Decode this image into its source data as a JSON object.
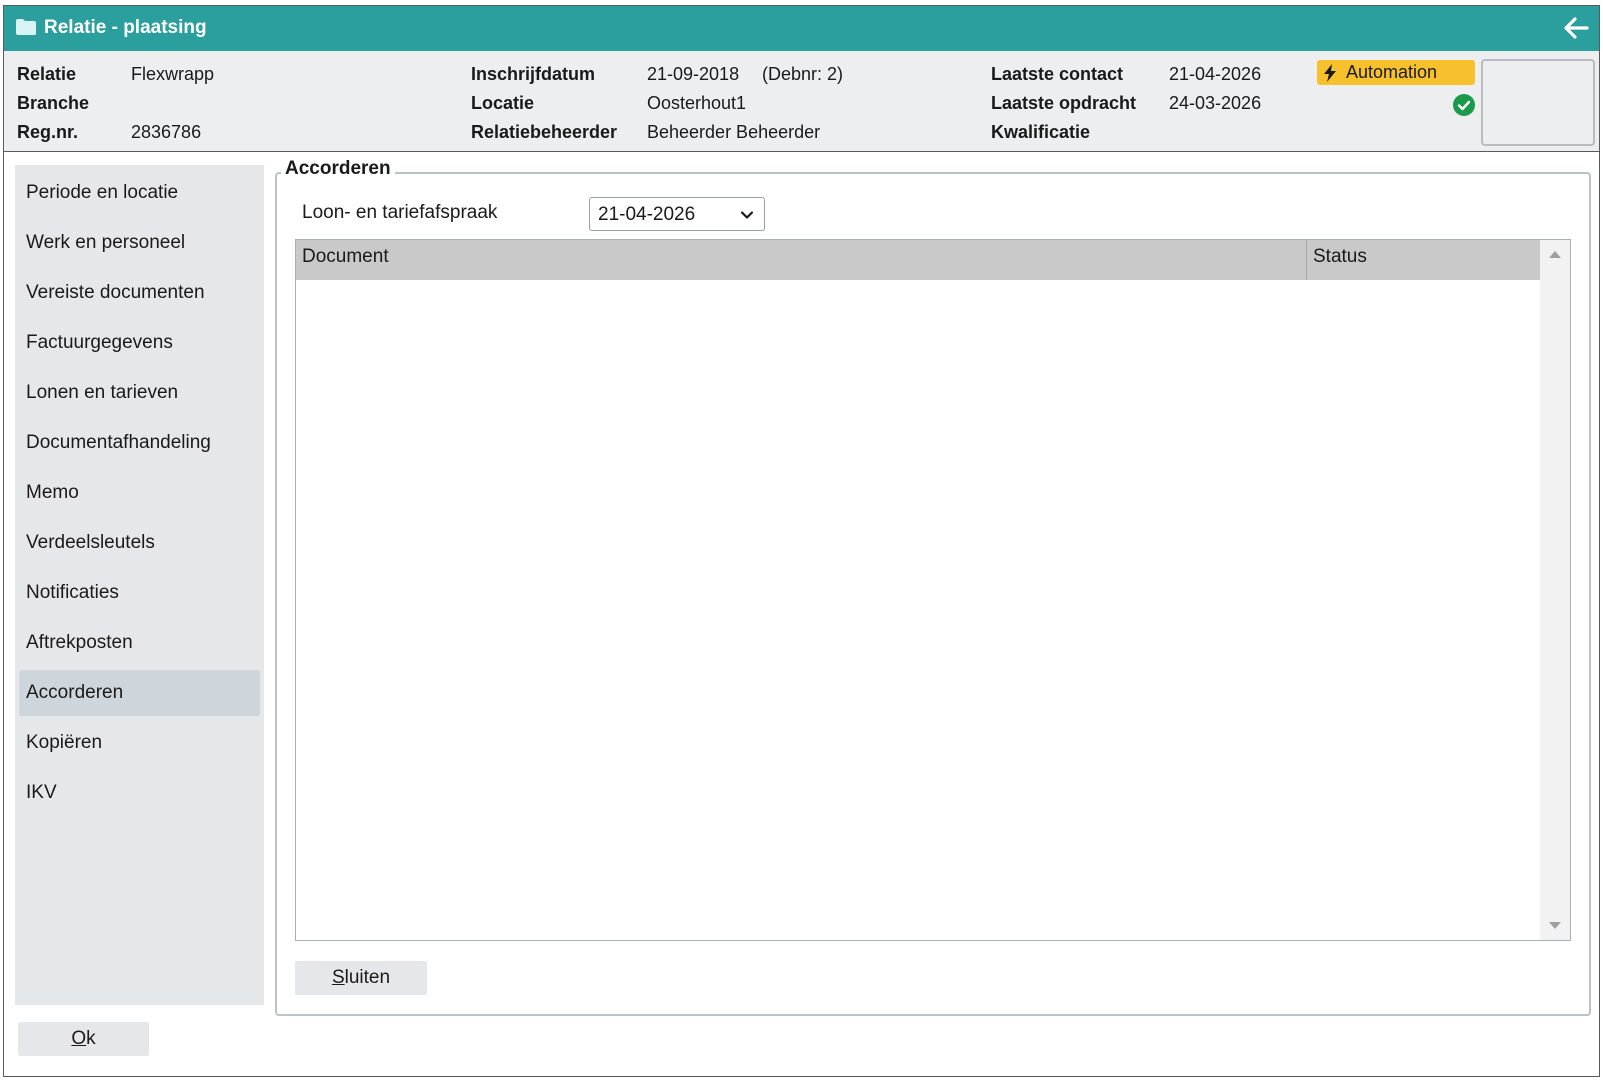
{
  "window": {
    "title": "Relatie - plaatsing"
  },
  "header": {
    "fields": [
      {
        "label": "Relatie",
        "value": "Flexwrapp"
      },
      {
        "label": "Branche",
        "value": ""
      },
      {
        "label": "Reg.nr.",
        "value": "2836786"
      },
      {
        "label": "Inschrijfdatum",
        "value": "21-09-2018",
        "extra": "(Debnr: 2)"
      },
      {
        "label": "Locatie",
        "value": "Oosterhout1"
      },
      {
        "label": "Relatiebeheerder",
        "value": "Beheerder Beheerder"
      },
      {
        "label": "Laatste contact",
        "value": "21-04-2026"
      },
      {
        "label": "Laatste opdracht",
        "value": "24-03-2026"
      },
      {
        "label": "Kwalificatie",
        "value": ""
      }
    ],
    "badge": {
      "label": "Automation",
      "icon": "bolt-icon",
      "color": "#f6c12c"
    },
    "status_icon": "check-circle-icon"
  },
  "sidebar": {
    "items": [
      {
        "label": "Periode en locatie"
      },
      {
        "label": "Werk en personeel"
      },
      {
        "label": "Vereiste documenten"
      },
      {
        "label": "Factuurgegevens"
      },
      {
        "label": "Lonen en tarieven"
      },
      {
        "label": "Documentafhandeling"
      },
      {
        "label": "Memo"
      },
      {
        "label": "Verdeelsleutels"
      },
      {
        "label": "Notificaties"
      },
      {
        "label": "Aftrekposten"
      },
      {
        "label": "Accorderen",
        "active": true
      },
      {
        "label": "Kopiëren"
      },
      {
        "label": "IKV"
      }
    ]
  },
  "main": {
    "section_title": "Accorderen",
    "loon_label": "Loon- en tariefafspraak",
    "loon_selected": "21-04-2026",
    "table": {
      "columns": [
        "Document",
        "Status"
      ],
      "rows": []
    },
    "close_button": {
      "underlined": "S",
      "rest": "luiten"
    }
  },
  "footer": {
    "ok_button": {
      "underlined": "O",
      "rest": "k"
    }
  },
  "colors": {
    "titlebar": "#2b9e9e",
    "header_bg": "#eceeef",
    "sidebar_bg": "#e4e8ea",
    "active_item": "#cfd6db",
    "table_header": "#c9c9c9",
    "success": "#1a9a4a"
  }
}
